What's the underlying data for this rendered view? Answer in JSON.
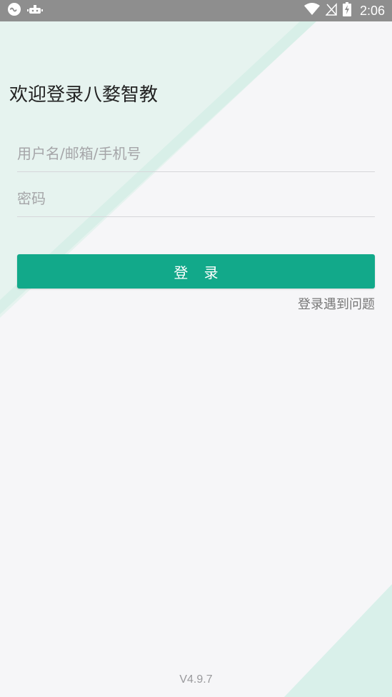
{
  "colors": {
    "accent": "#12a98a",
    "statusbar": "#8e8e8e",
    "background": "#f6f6f8",
    "decoration": "#d9f0ea"
  },
  "statusbar": {
    "left_icons": [
      "link-icon",
      "android-debug-icon"
    ],
    "right_icons": [
      "wifi-icon",
      "no-signal-icon",
      "battery-charging-icon"
    ],
    "time": "2:06"
  },
  "login": {
    "title": "欢迎登录八婺智教",
    "username_placeholder": "用户名/邮箱/手机号",
    "password_placeholder": "密码",
    "submit_label": "登 录",
    "help_link": "登录遇到问题"
  },
  "footer": {
    "version": "V4.9.7"
  }
}
